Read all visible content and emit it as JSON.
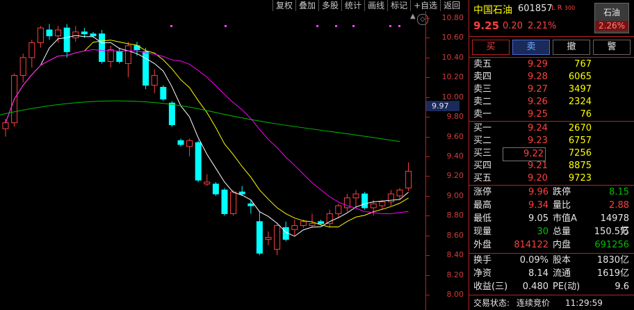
{
  "toolbar": [
    "复权",
    "叠加",
    "多股",
    "统计",
    "画线",
    "标记",
    "+自选",
    "返回"
  ],
  "axis_ticks": [
    "10.80",
    "10.60",
    "10.40",
    "10.20",
    "10.00",
    "9.80",
    "9.60",
    "9.40",
    "9.20",
    "9.00",
    "8.80",
    "8.60",
    "8.40",
    "8.20",
    "8.00"
  ],
  "current_price_tag": "9.97",
  "header": {
    "name": "中国石油",
    "code": "601857",
    "badge": "L R",
    "badge_num": "300",
    "price": "9.25",
    "change": "0.20",
    "pct": "2.21%",
    "sector_name": "石油",
    "sector_pct": "2.26%"
  },
  "trade_buttons": [
    "买",
    "卖",
    "撤",
    "警"
  ],
  "sells": [
    {
      "label": "卖五",
      "price": "9.29",
      "vol": "767"
    },
    {
      "label": "卖四",
      "price": "9.28",
      "vol": "6065"
    },
    {
      "label": "卖三",
      "price": "9.27",
      "vol": "3497"
    },
    {
      "label": "卖二",
      "price": "9.26",
      "vol": "2324"
    },
    {
      "label": "卖一",
      "price": "9.25",
      "vol": "76"
    }
  ],
  "buys": [
    {
      "label": "买一",
      "price": "9.24",
      "vol": "2670"
    },
    {
      "label": "买二",
      "price": "9.23",
      "vol": "6757"
    },
    {
      "label": "买三",
      "price": "9.22",
      "vol": "7256"
    },
    {
      "label": "买四",
      "price": "9.21",
      "vol": "8875"
    },
    {
      "label": "买五",
      "price": "9.20",
      "vol": "9723"
    }
  ],
  "stats": [
    {
      "l1": "涨停",
      "v1": "9.96",
      "l2": "跌停",
      "v2": "8.15"
    },
    {
      "l1": "最高",
      "v1": "9.34",
      "l2": "量比",
      "v2": "2.88"
    },
    {
      "l1": "最低",
      "v1": "9.05",
      "l2": "市值A",
      "v2": "14978亿"
    },
    {
      "l1": "现量",
      "v1": "30",
      "l2": "总量",
      "v2": "150.5万"
    },
    {
      "l1": "外盘",
      "v1": "814122",
      "l2": "内盘",
      "v2": "691256"
    }
  ],
  "stats2": [
    {
      "l1": "换手",
      "v1": "0.09%",
      "l2": "股本",
      "v2": "1830亿"
    },
    {
      "l1": "净资",
      "v1": "8.14",
      "l2": "流通",
      "v2": "1619亿"
    },
    {
      "l1": "收益(三)",
      "v1": "0.480",
      "l2": "PE(动)",
      "v2": "9.6"
    }
  ],
  "status": {
    "label": "交易状态:",
    "state": "连续竞价",
    "time": "11:29:59"
  },
  "colors": {
    "up": "#ff4040",
    "down": "#00ffff",
    "ma5": "#ffffff",
    "ma10": "#ffff00",
    "ma20": "#ff00ff",
    "ma60": "#00c000"
  }
}
